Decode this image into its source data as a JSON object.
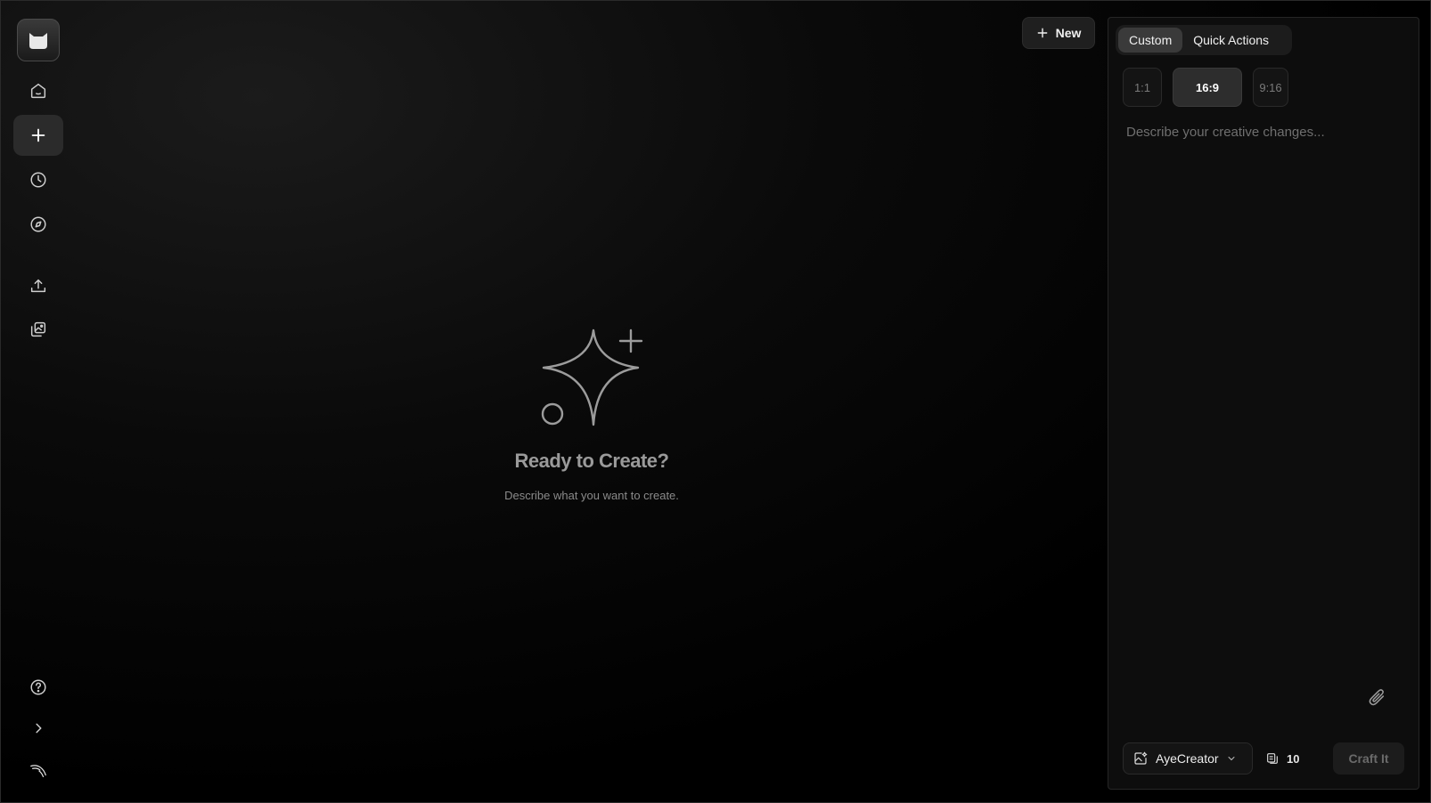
{
  "sidebar": {
    "items": [
      {
        "name": "home",
        "icon": "home-icon"
      },
      {
        "name": "create",
        "icon": "plus-icon",
        "active": true
      },
      {
        "name": "history",
        "icon": "clock-icon"
      },
      {
        "name": "explore",
        "icon": "compass-icon"
      },
      {
        "name": "upload",
        "icon": "upload-icon"
      },
      {
        "name": "gallery",
        "icon": "images-icon"
      }
    ],
    "bottom": [
      {
        "name": "help",
        "icon": "help-circle-icon"
      },
      {
        "name": "expand",
        "icon": "chevron-right-icon"
      },
      {
        "name": "kali",
        "icon": "dragon-logo-icon"
      }
    ]
  },
  "header": {
    "new_label": "New"
  },
  "empty_state": {
    "title": "Ready to Create?",
    "subtitle": "Describe what you want to create."
  },
  "panel": {
    "tabs": [
      {
        "label": "Custom",
        "active": true
      },
      {
        "label": "Quick Actions",
        "active": false
      }
    ],
    "ratios": [
      {
        "label": "1:1",
        "active": false
      },
      {
        "label": "16:9",
        "active": true
      },
      {
        "label": "9:16",
        "active": false
      }
    ],
    "prompt_placeholder": "Describe your creative changes...",
    "model": "AyeCreator",
    "credits": "10",
    "submit_label": "Craft It"
  },
  "colors": {
    "background": "#000000",
    "panel": "#0d0d0d",
    "active": "#2b2b2b"
  }
}
